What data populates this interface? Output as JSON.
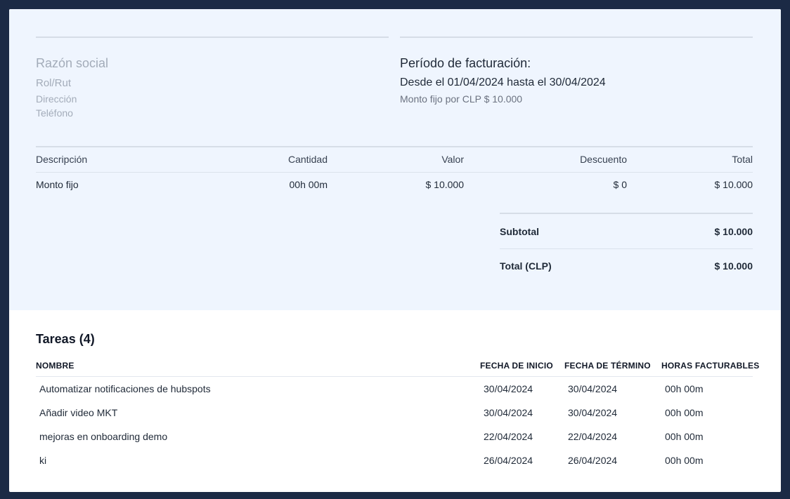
{
  "client": {
    "razon_social": "Razón social",
    "rol_rut": "Rol/Rut",
    "direccion": "Dirección",
    "telefono": "Teléfono"
  },
  "period": {
    "title": "Período de facturación:",
    "range": "Desde el 01/04/2024 hasta el 30/04/2024",
    "note": "Monto fijo por CLP $ 10.000"
  },
  "invoice_table": {
    "headers": {
      "descripcion": "Descripción",
      "cantidad": "Cantidad",
      "valor": "Valor",
      "descuento": "Descuento",
      "total": "Total"
    },
    "rows": [
      {
        "descripcion": "Monto fijo",
        "cantidad": "00h 00m",
        "valor": "$ 10.000",
        "descuento": "$ 0",
        "total": "$ 10.000"
      }
    ]
  },
  "totals": {
    "subtotal_label": "Subtotal",
    "subtotal_value": "$ 10.000",
    "total_label": "Total (CLP)",
    "total_value": "$ 10.000"
  },
  "tasks": {
    "title": "Tareas (4)",
    "headers": {
      "nombre": "NOMBRE",
      "fecha_inicio": "FECHA DE INICIO",
      "fecha_termino": "FECHA DE TÉRMINO",
      "horas": "HORAS FACTURABLES"
    },
    "rows": [
      {
        "nombre": "Automatizar notificaciones de hubspots",
        "fecha_inicio": "30/04/2024",
        "fecha_termino": "30/04/2024",
        "horas": "00h 00m"
      },
      {
        "nombre": "Añadir video MKT",
        "fecha_inicio": "30/04/2024",
        "fecha_termino": "30/04/2024",
        "horas": "00h 00m"
      },
      {
        "nombre": "mejoras en onboarding demo",
        "fecha_inicio": "22/04/2024",
        "fecha_termino": "22/04/2024",
        "horas": "00h 00m"
      },
      {
        "nombre": "ki",
        "fecha_inicio": "26/04/2024",
        "fecha_termino": "26/04/2024",
        "horas": "00h 00m"
      }
    ]
  }
}
